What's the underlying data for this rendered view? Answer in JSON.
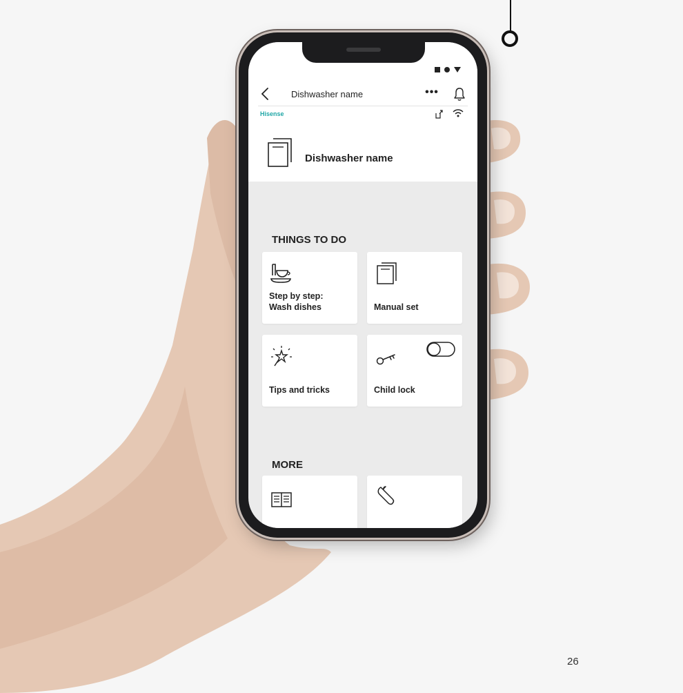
{
  "header": {
    "title": "Dishwasher name",
    "more_label": "•••"
  },
  "brand": "Hisense",
  "device": {
    "name": "Dishwasher name"
  },
  "things_to_do": {
    "title": "THINGS TO DO",
    "tiles": [
      {
        "label": "Step by step: Wash dishes",
        "icon": "dishes-icon"
      },
      {
        "label": "Manual set",
        "icon": "manual-set-icon"
      },
      {
        "label": "Tips and tricks",
        "icon": "sparkle-icon"
      },
      {
        "label": "Child lock",
        "icon": "key-icon",
        "toggle": "off"
      }
    ]
  },
  "more": {
    "title": "MORE",
    "tiles": [
      {
        "icon": "manual-book-icon"
      },
      {
        "icon": "wrench-icon"
      }
    ]
  },
  "page_number": "26",
  "colors": {
    "brand": "#21a7a7",
    "screen_bg": "#ebebeb",
    "tile_bg": "#ffffff"
  }
}
